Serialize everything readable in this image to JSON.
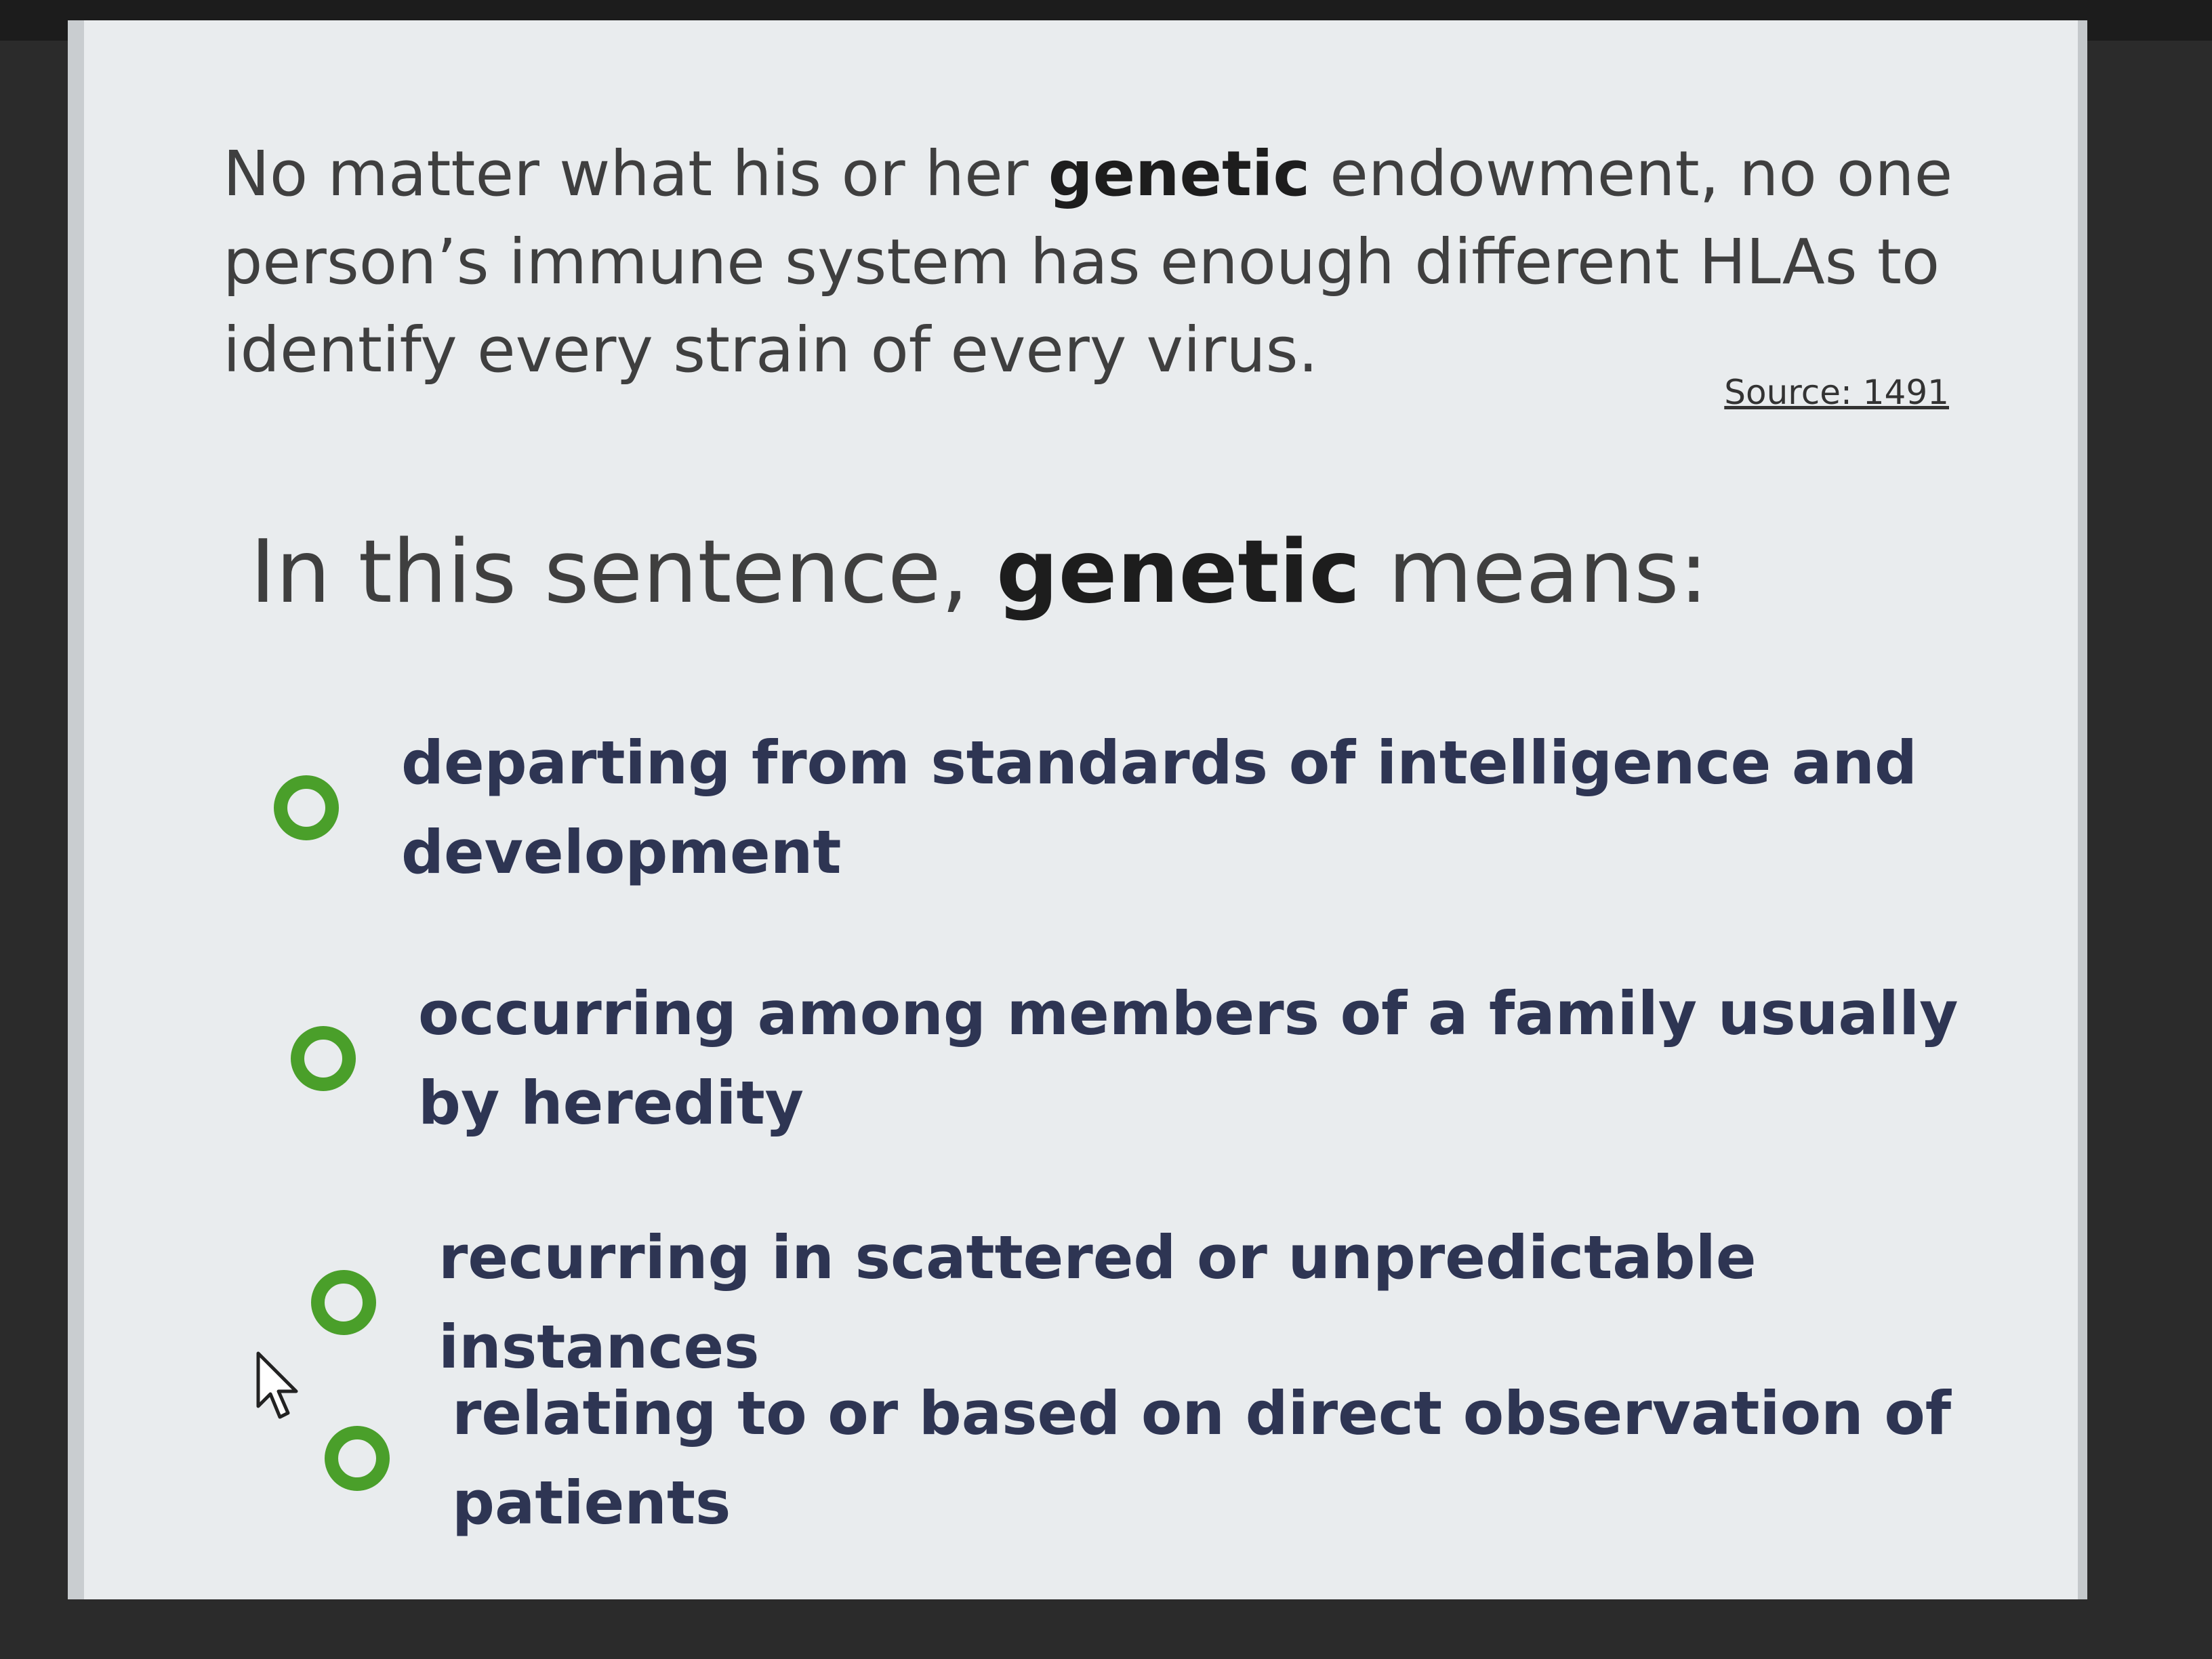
{
  "passage": {
    "before": "No matter what his or her ",
    "keyword": "genetic",
    "after": " endowment, no one person’s immune system has enough different HLAs to identify every strain of every virus."
  },
  "source_link": "Source: 1491",
  "question": {
    "before": "In this sentence, ",
    "keyword": "genetic",
    "after": " means:"
  },
  "options": [
    {
      "label": "departing from standards of intelligence and development",
      "selected": false
    },
    {
      "label": "occurring among members of a family usually by heredity",
      "selected": false
    },
    {
      "label": "recurring in scattered or unpredictable instances",
      "selected": false
    },
    {
      "label": "relating to or based on direct observation of patients",
      "selected": false
    }
  ],
  "colors": {
    "radio_ring": "#4a9f2a",
    "option_text": "#2e3553",
    "card_background": "#e9ecee"
  }
}
